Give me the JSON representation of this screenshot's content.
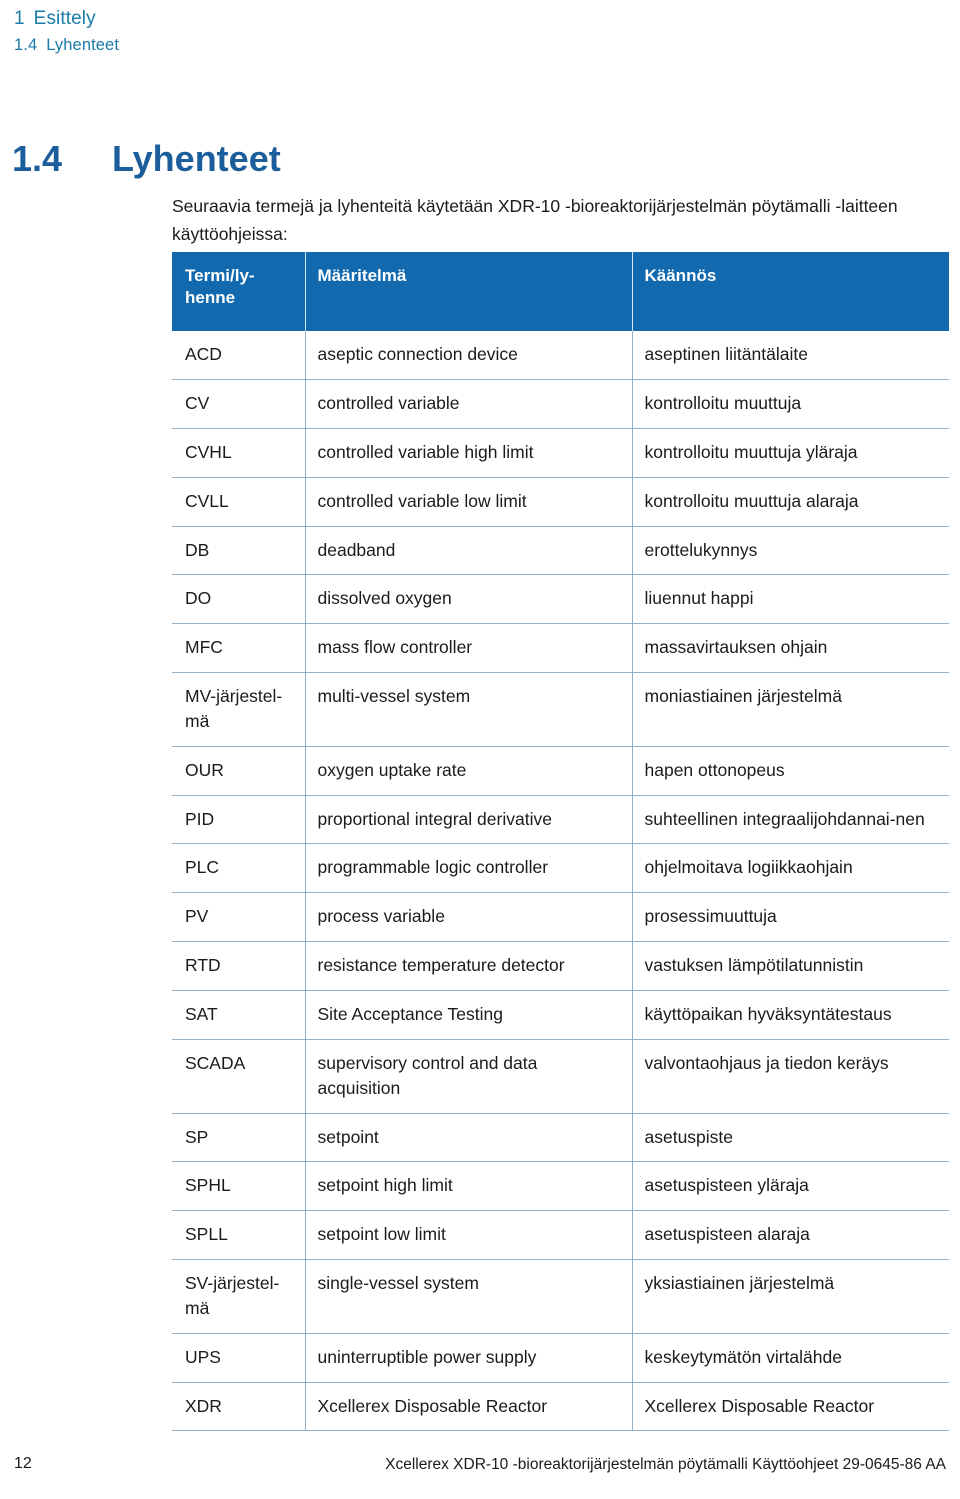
{
  "running_header": {
    "chapter_number": "1",
    "chapter_title": "Esittely",
    "section_number": "1.4",
    "section_title": "Lyhenteet"
  },
  "heading": {
    "number": "1.4",
    "title": "Lyhenteet"
  },
  "intro_paragraph": "Seuraavia termejä ja lyhenteitä käytetään XDR-10 -bioreaktorijärjestelmän pöytämalli -laitteen käyttöohjeissa:",
  "table": {
    "columns": [
      "Termi/ly-\nhenne",
      "Määritelmä",
      "Käännös"
    ],
    "header_background": "#1369ae",
    "header_text_color": "#ffffff",
    "border_color": "#93b2c9",
    "rows": [
      {
        "term": "ACD",
        "definition": "aseptic connection device",
        "translation": "aseptinen liitäntälaite"
      },
      {
        "term": "CV",
        "definition": "controlled variable",
        "translation": "kontrolloitu muuttuja"
      },
      {
        "term": "CVHL",
        "definition": "controlled variable high limit",
        "translation": "kontrolloitu muuttuja yläraja"
      },
      {
        "term": "CVLL",
        "definition": "controlled variable low limit",
        "translation": "kontrolloitu muuttuja alaraja"
      },
      {
        "term": "DB",
        "definition": "deadband",
        "translation": "erottelukynnys"
      },
      {
        "term": "DO",
        "definition": "dissolved oxygen",
        "translation": "liuennut happi"
      },
      {
        "term": "MFC",
        "definition": "mass flow controller",
        "translation": "massavirtauksen ohjain"
      },
      {
        "term": "MV-järjestel-\nmä",
        "definition": "multi-vessel system",
        "translation": "moniastiainen järjestelmä"
      },
      {
        "term": "OUR",
        "definition": "oxygen uptake rate",
        "translation": "hapen ottonopeus"
      },
      {
        "term": "PID",
        "definition": "proportional integral derivative",
        "translation": "suhteellinen integraalijohdannai-nen"
      },
      {
        "term": "PLC",
        "definition": "programmable logic controller",
        "translation": "ohjelmoitava logiikkaohjain"
      },
      {
        "term": "PV",
        "definition": "process variable",
        "translation": "prosessimuuttuja"
      },
      {
        "term": "RTD",
        "definition": "resistance temperature detector",
        "translation": "vastuksen lämpötilatunnistin"
      },
      {
        "term": "SAT",
        "definition": "Site Acceptance Testing",
        "translation": "käyttöpaikan hyväksyntätestaus"
      },
      {
        "term": "SCADA",
        "definition": "supervisory control and data acquisition",
        "translation": "valvontaohjaus ja tiedon keräys"
      },
      {
        "term": "SP",
        "definition": "setpoint",
        "translation": "asetuspiste"
      },
      {
        "term": "SPHL",
        "definition": "setpoint high limit",
        "translation": "asetuspisteen yläraja"
      },
      {
        "term": "SPLL",
        "definition": "setpoint low limit",
        "translation": "asetuspisteen alaraja"
      },
      {
        "term": "SV-järjestel-\nmä",
        "definition": "single-vessel system",
        "translation": "yksiastiainen järjestelmä"
      },
      {
        "term": "UPS",
        "definition": "uninterruptible power supply",
        "translation": "keskeytymätön virtalähde"
      },
      {
        "term": "XDR",
        "definition": "Xcellerex Disposable Reactor",
        "translation": "Xcellerex Disposable Reactor"
      }
    ]
  },
  "footer": {
    "page_number": "12",
    "document_title": "Xcellerex XDR-10 -bioreaktorijärjestelmän pöytämalli Käyttöohjeet 29-0645-86 AA"
  }
}
